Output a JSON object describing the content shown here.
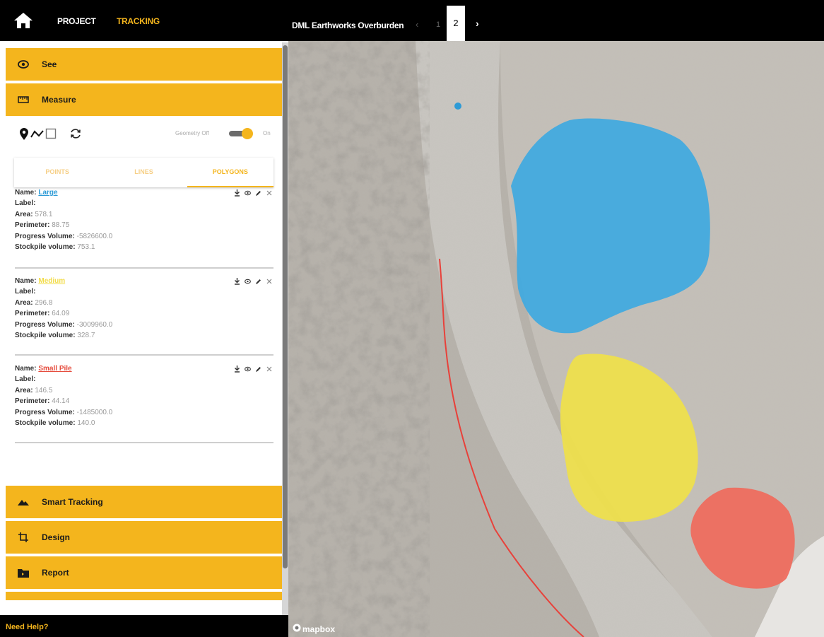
{
  "nav": {
    "project_label": "PROJECT",
    "tracking_label": "TRACKING",
    "project_title": "DML Earthworks Overburden",
    "pager": {
      "prev": "‹",
      "pages": [
        "1",
        "2"
      ],
      "current": "2",
      "next": "›"
    }
  },
  "sidebar": {
    "sections": {
      "see": "See",
      "measure": "Measure",
      "smart_tracking": "Smart Tracking",
      "design": "Design",
      "report": "Report"
    },
    "geometry_off": "Geometry Off",
    "geometry_on": "On",
    "geometry_enabled": true,
    "tabs": [
      "POINTS",
      "LINES",
      "POLYGONS"
    ],
    "active_tab": "POLYGONS",
    "labels": {
      "name": "Name:",
      "label": "Label:",
      "area": "Area:",
      "perimeter": "Perimeter:",
      "progress_volume": "Progress Volume:",
      "stockpile_volume": "Stockpile volume:"
    },
    "polygons": [
      {
        "name": "Large",
        "color": "#2e9bd6",
        "label": "",
        "area": "578.1",
        "perimeter": "88.75",
        "progress_volume": "-5826600.0",
        "stockpile_volume": "753.1"
      },
      {
        "name": "Medium",
        "color": "#f2dc4a",
        "label": "",
        "area": "296.8",
        "perimeter": "64.09",
        "progress_volume": "-3009960.0",
        "stockpile_volume": "328.7"
      },
      {
        "name": "Small Pile",
        "color": "#e54b3c",
        "label": "",
        "area": "146.5",
        "perimeter": "44.14",
        "progress_volume": "-1485000.0",
        "stockpile_volume": "140.0"
      }
    ],
    "need_help": "Need Help?"
  },
  "map": {
    "attribution": "mapbox",
    "colors": {
      "blue": "#3fa9e0",
      "yellow": "#efe04a",
      "red": "#ef6a5c",
      "line": "#e8413a"
    }
  }
}
